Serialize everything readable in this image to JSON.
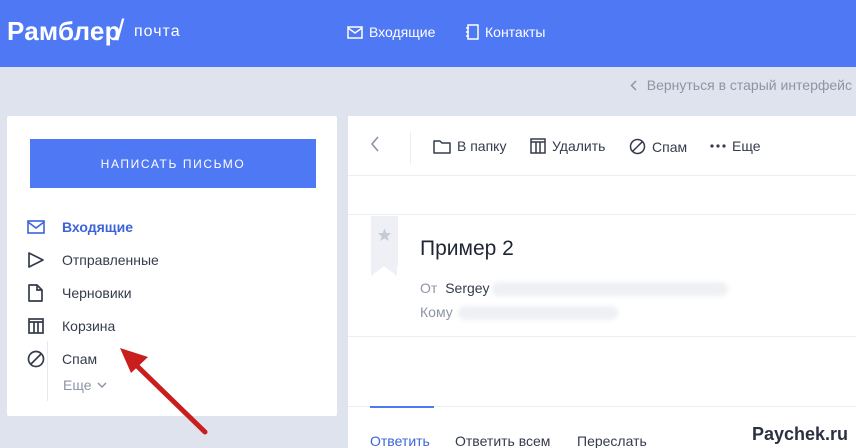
{
  "header": {
    "logo": "Рамблер",
    "logo_slash": "/",
    "logo_sub": "почта",
    "nav_inbox": "Входящие",
    "nav_contacts": "Контакты"
  },
  "subbar": {
    "back_old": "Вернуться в старый интерфейс"
  },
  "sidebar": {
    "compose": "НАПИСАТЬ ПИСЬМО",
    "folders": [
      {
        "label": "Входящие",
        "icon": "envelope-icon",
        "active": true
      },
      {
        "label": "Отправленные",
        "icon": "send-icon"
      },
      {
        "label": "Черновики",
        "icon": "draft-icon"
      },
      {
        "label": "Корзина",
        "icon": "trash-icon"
      },
      {
        "label": "Спам",
        "icon": "spam-icon"
      }
    ],
    "more": "Еще"
  },
  "toolbar": {
    "to_folder": "В папку",
    "delete": "Удалить",
    "spam": "Спам",
    "more": "Еще"
  },
  "message": {
    "subject": "Пример 2",
    "from_label": "От",
    "from_value": "Sergey",
    "to_label": "Кому"
  },
  "reply": {
    "reply": "Ответить",
    "reply_all": "Ответить всем",
    "forward": "Переслать"
  },
  "watermark": "Paychek.ru",
  "colors": {
    "brand": "#4f78f5",
    "accent_text": "#3c64d9",
    "annotation_arrow": "#c81e1e"
  }
}
